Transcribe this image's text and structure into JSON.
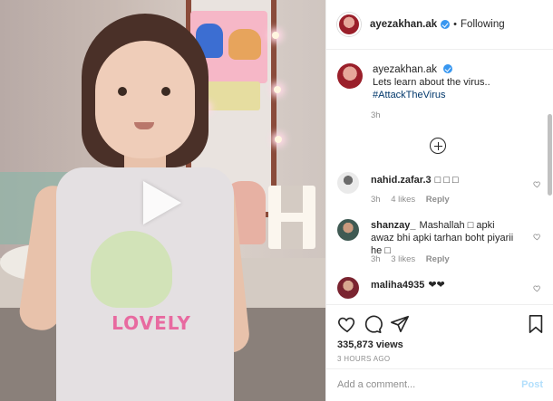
{
  "post": {
    "header": {
      "username": "ayezakhan.ak",
      "separator": "•",
      "follow_status": "Following"
    },
    "caption": {
      "username": "ayezakhan.ak",
      "text": "Lets learn about the virus..",
      "hashtag": "#AttackTheVirus",
      "time": "3h"
    },
    "comments": [
      {
        "username": "nahid.zafar.3",
        "text": "□ □ □",
        "time": "3h",
        "likes": "4 likes",
        "reply": "Reply"
      },
      {
        "username": "shanzay_",
        "text": "Mashallah □ apki awaz bhi apki tarhan boht piyarii he □",
        "time": "3h",
        "likes": "3 likes",
        "reply": "Reply"
      },
      {
        "username": "maliha4935",
        "text": "❤❤",
        "time": "",
        "likes": "",
        "reply": ""
      }
    ],
    "media": {
      "shirt_text": "LOVELY"
    },
    "stats": {
      "views": "335,873 views",
      "time_ago": "3 HOURS AGO"
    },
    "add_comment": {
      "placeholder": "Add a comment...",
      "post_label": "Post"
    },
    "colors": {
      "link": "#00376b",
      "verified": "#3897f0",
      "post_disabled": "#b2dffc",
      "muted": "#8e8e8e"
    },
    "icons": [
      "verified-badge-icon",
      "add-circle-icon",
      "heart-icon",
      "comment-icon",
      "share-icon",
      "bookmark-icon",
      "play-icon"
    ]
  }
}
